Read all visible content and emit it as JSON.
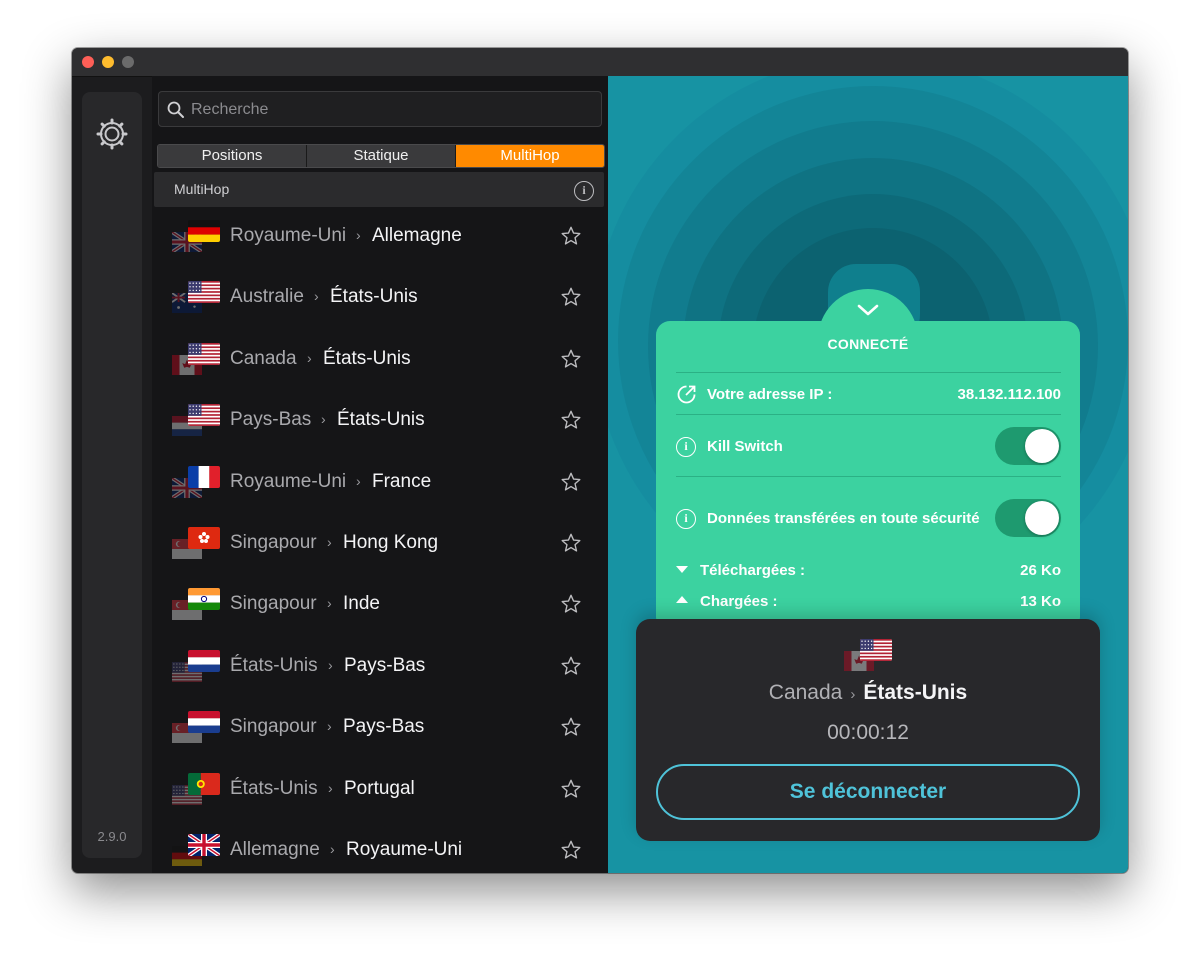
{
  "app": {
    "version": "2.9.0"
  },
  "search": {
    "placeholder": "Recherche",
    "value": ""
  },
  "tabs": [
    {
      "label": "Positions",
      "active": false
    },
    {
      "label": "Statique",
      "active": false
    },
    {
      "label": "MultiHop",
      "active": true
    }
  ],
  "section": {
    "title": "MultiHop"
  },
  "locations": [
    {
      "from": "Royaume-Uni",
      "to": "Allemagne",
      "from_flag": "uk",
      "to_flag": "de"
    },
    {
      "from": "Australie",
      "to": "États-Unis",
      "from_flag": "au",
      "to_flag": "us"
    },
    {
      "from": "Canada",
      "to": "États-Unis",
      "from_flag": "ca",
      "to_flag": "us"
    },
    {
      "from": "Pays-Bas",
      "to": "États-Unis",
      "from_flag": "nl",
      "to_flag": "us"
    },
    {
      "from": "Royaume-Uni",
      "to": "France",
      "from_flag": "uk",
      "to_flag": "fr"
    },
    {
      "from": "Singapour",
      "to": "Hong Kong",
      "from_flag": "sg",
      "to_flag": "hk"
    },
    {
      "from": "Singapour",
      "to": "Inde",
      "from_flag": "sg",
      "to_flag": "in"
    },
    {
      "from": "États-Unis",
      "to": "Pays-Bas",
      "from_flag": "us",
      "to_flag": "nl"
    },
    {
      "from": "Singapour",
      "to": "Pays-Bas",
      "from_flag": "sg",
      "to_flag": "nl"
    },
    {
      "from": "États-Unis",
      "to": "Portugal",
      "from_flag": "us",
      "to_flag": "pt"
    },
    {
      "from": "Allemagne",
      "to": "Royaume-Uni",
      "from_flag": "de",
      "to_flag": "uk"
    }
  ],
  "status": {
    "title": "CONNECTÉ",
    "ip_label": "Votre adresse IP :",
    "ip_value": "38.132.112.100",
    "kill_switch_label": "Kill Switch",
    "kill_switch_on": true,
    "secure_data_label": "Données transférées en toute sécurité",
    "secure_data_on": true,
    "download_label": "Téléchargées :",
    "download_value": "26 Ko",
    "upload_label": "Chargées :",
    "upload_value": "13 Ko"
  },
  "connection": {
    "from": "Canada",
    "to": "États-Unis",
    "from_flag": "ca",
    "to_flag": "us",
    "timer": "00:00:12",
    "disconnect_label": "Se déconnecter"
  },
  "colors": {
    "accent_orange": "#ff8a00",
    "status_green": "#3cd2a0",
    "background_teal": "#1793a3",
    "button_blue": "#4fc3d9"
  },
  "icons": {
    "settings": "gear-icon",
    "search": "search-icon",
    "info": "info-icon",
    "favorite": "star-icon",
    "external_ip": "external-link-icon"
  }
}
